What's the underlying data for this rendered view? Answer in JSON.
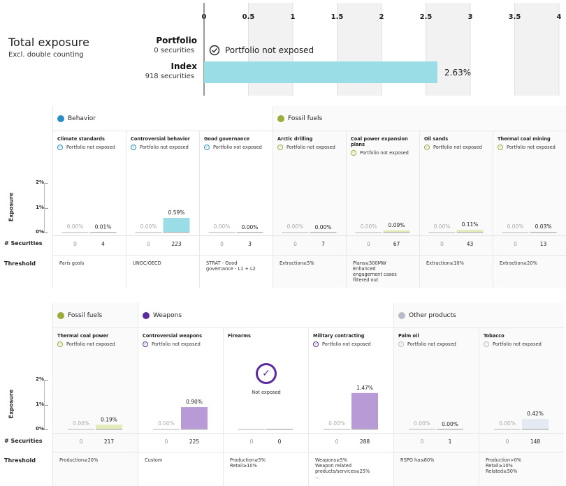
{
  "total_exposure": {
    "title": "Total exposure",
    "subtitle": "Excl. double counting",
    "portfolio_label": "Portfolio",
    "portfolio_count": "0 securities",
    "portfolio_status": "Portfolio not exposed",
    "index_label": "Index",
    "index_count": "918 securities",
    "index_value_label": "2.63%"
  },
  "labels": {
    "y_axis": "Exposure",
    "securities_row": "# Securities",
    "threshold_row": "Threshold",
    "portfolio_not_exposed": "Portfolio not exposed",
    "not_exposed": "Not exposed",
    "ticks": [
      "0%",
      "1%",
      "2%"
    ]
  },
  "colors": {
    "behavior": "#2a8fc2",
    "fossil": "#9cab3a",
    "weapons": "#5b2a9c",
    "other": "#b8bcc8",
    "index_top": "#9bdde6",
    "bar_behavior": "#9bdde6",
    "bar_fossil": "#e3ebb8",
    "bar_weapons": "#b89ad6",
    "bar_other": "#e4e9f2"
  },
  "chart_data": [
    {
      "type": "bar",
      "title": "Total exposure",
      "categories": [
        "Portfolio",
        "Index"
      ],
      "values": [
        0,
        2.63
      ],
      "x_ticks": [
        "0",
        "0.5",
        "1",
        "1.5",
        "2",
        "2.5",
        "3",
        "3.5",
        "4"
      ],
      "xlim": [
        0,
        4
      ],
      "grid": true
    },
    {
      "type": "bar",
      "groups": [
        {
          "name": "Behavior",
          "color_key": "behavior",
          "bar_key": "bar_behavior",
          "span": [
            0,
            3
          ]
        },
        {
          "name": "Fossil fuels",
          "color_key": "fossil",
          "bar_key": "bar_fossil",
          "span": [
            3,
            7
          ]
        }
      ],
      "categories": [
        {
          "name": "Climate standards",
          "status": "Portfolio not exposed",
          "portfolio": 0,
          "index": 0.01,
          "portfolio_label": "0.00%",
          "index_label": "0.01%",
          "portfolio_securities": "0",
          "index_securities": "4",
          "threshold": [
            "Paris goals"
          ]
        },
        {
          "name": "Controversial behavior",
          "status": "Portfolio not exposed",
          "portfolio": 0,
          "index": 0.59,
          "portfolio_label": "0.00%",
          "index_label": "0.59%",
          "portfolio_securities": "0",
          "index_securities": "223",
          "threshold": [
            "UNGC/OECD"
          ]
        },
        {
          "name": "Good governance",
          "status": "Portfolio not exposed",
          "portfolio": 0,
          "index": 0,
          "portfolio_label": "0.00%",
          "index_label": "0.00%",
          "portfolio_securities": "0",
          "index_securities": "3",
          "threshold": [
            "STRAT - Good",
            "governance - L1 + L2"
          ]
        },
        {
          "name": "Arctic drilling",
          "status": "Portfolio not exposed",
          "portfolio": 0,
          "index": 0,
          "portfolio_label": "0.00%",
          "index_label": "0.00%",
          "portfolio_securities": "0",
          "index_securities": "7",
          "threshold": [
            "Extraction≥5%"
          ]
        },
        {
          "name": "Coal power expansion plans",
          "status": "Portfolio not exposed",
          "portfolio": 0,
          "index": 0.09,
          "portfolio_label": "0.00%",
          "index_label": "0.09%",
          "portfolio_securities": "0",
          "index_securities": "67",
          "threshold": [
            "Plans≥300MW",
            "Enhanced",
            "engagement cases",
            "filtered out"
          ]
        },
        {
          "name": "Oil sands",
          "status": "Portfolio not exposed",
          "portfolio": 0,
          "index": 0.11,
          "portfolio_label": "0.00%",
          "index_label": "0.11%",
          "portfolio_securities": "0",
          "index_securities": "43",
          "threshold": [
            "Extraction≥10%"
          ]
        },
        {
          "name": "Thermal coal mining",
          "status": "Portfolio not exposed",
          "portfolio": 0,
          "index": 0.03,
          "portfolio_label": "0.00%",
          "index_label": "0.03%",
          "portfolio_securities": "0",
          "index_securities": "13",
          "threshold": [
            "Extraction≥20%"
          ]
        }
      ],
      "ylim": [
        0,
        2.4
      ]
    },
    {
      "type": "bar",
      "groups": [
        {
          "name": "Fossil fuels",
          "color_key": "fossil",
          "bar_key": "bar_fossil",
          "span": [
            0,
            1
          ]
        },
        {
          "name": "Weapons",
          "color_key": "weapons",
          "bar_key": "bar_weapons",
          "span": [
            1,
            4
          ]
        },
        {
          "name": "Other products",
          "color_key": "other",
          "bar_key": "bar_other",
          "span": [
            4,
            6
          ]
        }
      ],
      "categories": [
        {
          "name": "Thermal coal power",
          "status": "Portfolio not exposed",
          "portfolio": 0,
          "index": 0.19,
          "portfolio_label": "0.00%",
          "index_label": "0.19%",
          "portfolio_securities": "0",
          "index_securities": "217",
          "threshold": [
            "Production≥20%"
          ]
        },
        {
          "name": "Controversial weapons",
          "status": "Portfolio not exposed",
          "portfolio": 0,
          "index": 0.9,
          "portfolio_label": "0.00%",
          "index_label": "0.90%",
          "portfolio_securities": "0",
          "index_securities": "225",
          "threshold": [
            "Custom"
          ]
        },
        {
          "name": "Firearms",
          "status": "",
          "not_exposed": true,
          "portfolio": 0,
          "index": 0,
          "portfolio_label": "",
          "index_label": "",
          "portfolio_securities": "0",
          "index_securities": "0",
          "threshold": [
            "Production≥5%",
            "Retail≥10%"
          ]
        },
        {
          "name": "Military contracting",
          "status": "Portfolio not exposed",
          "portfolio": 0,
          "index": 1.47,
          "portfolio_label": "0.00%",
          "index_label": "1.47%",
          "portfolio_securities": "0",
          "index_securities": "288",
          "threshold": [
            "Weapons≥5%",
            "Weapon related",
            "products/services≥25%",
            "..."
          ]
        },
        {
          "name": "Palm oil",
          "status": "Portfolio not exposed",
          "portfolio": 0,
          "index": 0,
          "portfolio_label": "0.00%",
          "index_label": "0.00%",
          "portfolio_securities": "0",
          "index_securities": "1",
          "threshold": [
            "RSPO ha≤80%"
          ]
        },
        {
          "name": "Tobacco",
          "status": "Portfolio not exposed",
          "portfolio": 0,
          "index": 0.42,
          "portfolio_label": "0.00%",
          "index_label": "0.42%",
          "portfolio_securities": "0",
          "index_securities": "148",
          "threshold": [
            "Production>0%",
            "Retail≥10%",
            "Related≥50%"
          ]
        }
      ],
      "ylim": [
        0,
        2.4
      ]
    }
  ]
}
